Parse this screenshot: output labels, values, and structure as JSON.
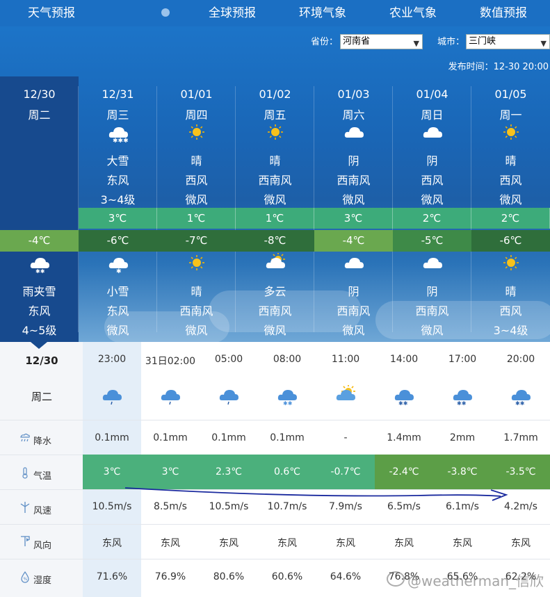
{
  "nav": {
    "items": [
      "天气预报",
      "全球预报",
      "环境气象",
      "农业气象",
      "数值预报"
    ]
  },
  "filters": {
    "province_label": "省份：",
    "province_value": "河南省",
    "city_label": "城市：",
    "city_value": "三门峡"
  },
  "publish_time": "发布时间：12-30 20:00",
  "days": [
    {
      "date": "12/30",
      "weekday": "周二",
      "day_weather": "",
      "day_wind_dir": "",
      "day_wind_level": "",
      "high": "",
      "low": "-4℃",
      "night_icon": "sleet-icon",
      "night_weather": "雨夹雪",
      "night_wind_dir": "东风",
      "night_wind_level": "4~5级"
    },
    {
      "date": "12/31",
      "weekday": "周三",
      "day_icon": "heavy-snow-icon",
      "day_weather": "大雪",
      "day_wind_dir": "东风",
      "day_wind_level": "3~4级",
      "high": "3℃",
      "low": "-6℃",
      "night_icon": "light-snow-icon",
      "night_weather": "小雪",
      "night_wind_dir": "东风",
      "night_wind_level": "微风"
    },
    {
      "date": "01/01",
      "weekday": "周四",
      "day_icon": "sunny-icon",
      "day_weather": "晴",
      "day_wind_dir": "西风",
      "day_wind_level": "微风",
      "high": "1℃",
      "low": "-7℃",
      "night_icon": "sunny-icon",
      "night_weather": "晴",
      "night_wind_dir": "西南风",
      "night_wind_level": "微风"
    },
    {
      "date": "01/02",
      "weekday": "周五",
      "day_icon": "sunny-icon",
      "day_weather": "晴",
      "day_wind_dir": "西南风",
      "day_wind_level": "微风",
      "high": "1℃",
      "low": "-8℃",
      "night_icon": "partly-cloudy-icon",
      "night_weather": "多云",
      "night_wind_dir": "西南风",
      "night_wind_level": "微风"
    },
    {
      "date": "01/03",
      "weekday": "周六",
      "day_icon": "overcast-icon",
      "day_weather": "阴",
      "day_wind_dir": "西南风",
      "day_wind_level": "微风",
      "high": "3℃",
      "low": "-4℃",
      "night_icon": "overcast-icon",
      "night_weather": "阴",
      "night_wind_dir": "西南风",
      "night_wind_level": "微风"
    },
    {
      "date": "01/04",
      "weekday": "周日",
      "day_icon": "overcast-icon",
      "day_weather": "阴",
      "day_wind_dir": "西风",
      "day_wind_level": "微风",
      "high": "2℃",
      "low": "-5℃",
      "night_icon": "overcast-icon",
      "night_weather": "阴",
      "night_wind_dir": "西南风",
      "night_wind_level": "微风"
    },
    {
      "date": "01/05",
      "weekday": "周一",
      "day_icon": "sunny-icon",
      "day_weather": "晴",
      "day_wind_dir": "西风",
      "day_wind_level": "微风",
      "high": "2℃",
      "low": "-6℃",
      "night_icon": "sunny-icon",
      "night_weather": "晴",
      "night_wind_dir": "西风",
      "night_wind_level": "3~4级"
    }
  ],
  "low_band_colors": [
    "#6aa84f",
    "#2f6e3b",
    "#2f6e3b",
    "#2f6e3b",
    "#6aa84f",
    "#3e8a48",
    "#2f6e3b"
  ],
  "hourly": {
    "date": "12/30",
    "weekday": "周二",
    "row_labels": {
      "precip": "降水",
      "temp": "气温",
      "wind_speed": "风速",
      "wind_dir": "风向",
      "humidity": "湿度"
    },
    "times": [
      "23:00",
      "31日02:00",
      "05:00",
      "08:00",
      "11:00",
      "14:00",
      "17:00",
      "20:00"
    ],
    "icons": [
      "light-rain-icon",
      "light-rain-icon",
      "light-rain-icon",
      "sleet-icon",
      "partly-cloudy-icon",
      "snow-icon",
      "snow-icon",
      "snow-icon"
    ],
    "precip": [
      "0.1mm",
      "0.1mm",
      "0.1mm",
      "0.1mm",
      "-",
      "1.4mm",
      "2mm",
      "1.7mm"
    ],
    "temp": [
      "3℃",
      "3℃",
      "2.3℃",
      "0.6℃",
      "-0.7℃",
      "-2.4℃",
      "-3.8℃",
      "-3.5℃"
    ],
    "temp_colors": [
      "#4bb07c",
      "#4bb07c",
      "#4bb07c",
      "#4bb07c",
      "#4bb07c",
      "#5c9e47",
      "#5c9e47",
      "#5c9e47"
    ],
    "wind_speed": [
      "10.5m/s",
      "8.5m/s",
      "10.5m/s",
      "10.7m/s",
      "7.9m/s",
      "6.5m/s",
      "6.1m/s",
      "4.2m/s"
    ],
    "wind_dir": [
      "东风",
      "东风",
      "东风",
      "东风",
      "东风",
      "东风",
      "东风",
      "东风"
    ],
    "humidity": [
      "71.6%",
      "76.9%",
      "80.6%",
      "60.6%",
      "64.6%",
      "76.8%",
      "65.6%",
      "62.2%"
    ]
  },
  "watermark": "@weatherman_信欣",
  "colors": {
    "nav": "#1b6fc3",
    "high_band": "#3dab7a",
    "annotation_line": "#1a2a9e"
  }
}
